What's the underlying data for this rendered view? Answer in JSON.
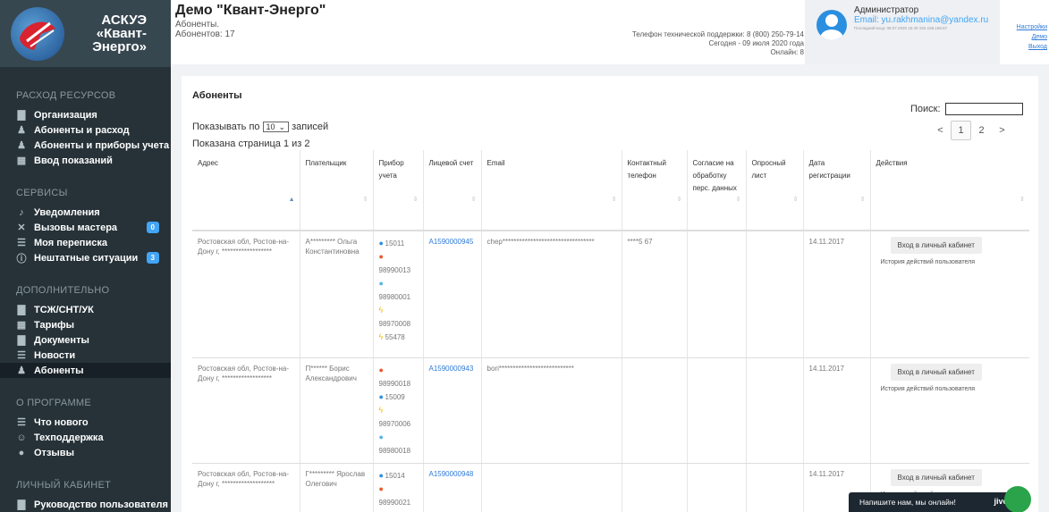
{
  "brand": {
    "line1": "АСКУЭ",
    "line2": "«Квант-",
    "line3": "Энерго»"
  },
  "sidebar": {
    "sections": [
      {
        "title": "РАСХОД РЕСУРСОВ",
        "items": [
          {
            "label": "Организация",
            "icon": "folder-icon"
          },
          {
            "label": "Абоненты и расход",
            "icon": "user-icon"
          },
          {
            "label": "Абоненты и приборы учета",
            "icon": "user-icon"
          },
          {
            "label": "Ввод показаний",
            "icon": "chart-icon"
          }
        ]
      },
      {
        "title": "СЕРВИСЫ",
        "items": [
          {
            "label": "Уведомления",
            "icon": "bell-icon"
          },
          {
            "label": "Вызовы мастера",
            "icon": "tools-icon",
            "badge": "0"
          },
          {
            "label": "Моя переписка",
            "icon": "list-icon"
          },
          {
            "label": "Нештатные ситуации",
            "icon": "alert-icon",
            "badge": "3"
          }
        ]
      },
      {
        "title": "ДОПОЛНИТЕЛЬНО",
        "items": [
          {
            "label": "ТСЖ/СНТ/УК",
            "icon": "folder-icon"
          },
          {
            "label": "Тарифы",
            "icon": "chart-icon"
          },
          {
            "label": "Документы",
            "icon": "folder-icon"
          },
          {
            "label": "Новости",
            "icon": "list-icon"
          },
          {
            "label": "Абоненты",
            "icon": "user-icon",
            "active": true
          }
        ]
      },
      {
        "title": "О ПРОГРАММЕ",
        "items": [
          {
            "label": "Что нового",
            "icon": "list-icon"
          },
          {
            "label": "Техподдержка",
            "icon": "support-icon"
          },
          {
            "label": "Отзывы",
            "icon": "comment-icon"
          }
        ]
      },
      {
        "title": "ЛИЧНЫЙ КАБИНЕТ",
        "items": [
          {
            "label": "Руководство пользователя",
            "icon": "folder-icon"
          }
        ]
      }
    ]
  },
  "header": {
    "title": "Демо \"Квант-Энерго\"",
    "subtitle1": "Абоненты.",
    "subtitle2": "Абонентов: 17",
    "support": "Телефон технической поддержки: 8 (800) 250-79-14",
    "today": "Сегодня - 09 июля 2020 года",
    "online": "Онлайн: 8",
    "user_name": "Администратор",
    "user_email": "Email: yu.rakhmanina@yandex.ru",
    "last_login": "Последний вход: 08.07.2020 15:40 192.168.158.67",
    "links": [
      "Настройки",
      "Демо",
      "Выход"
    ]
  },
  "panel": {
    "title": "Абоненты",
    "search_label": "Поиск:",
    "show_prefix": "Показывать по",
    "show_value": "10",
    "show_suffix": "записей",
    "shown_page": "Показана страница 1 из 2",
    "pager": {
      "prev": "<",
      "pages": [
        "1",
        "2"
      ],
      "next": ">"
    }
  },
  "table": {
    "columns": [
      "Адрес",
      "Плательщик",
      "Прибор учета",
      "Лицевой счет",
      "Email",
      "Контактный телефон",
      "Согласие на обработку перс. данных",
      "Опросный лист",
      "Дата регистрации",
      "Действия"
    ],
    "rows": [
      {
        "address": "Ростовская обл, Ростов-на-Дону г, ******************",
        "payer": "А********* Ольга Константиновна",
        "meters": [
          {
            "type": "blue",
            "no": "15011"
          },
          {
            "type": "red",
            "no": ""
          },
          {
            "type": "none",
            "no": "98990013"
          },
          {
            "type": "lblue",
            "no": ""
          },
          {
            "type": "none",
            "no": "98980001"
          },
          {
            "type": "yel",
            "no": ""
          },
          {
            "type": "none",
            "no": "98970008"
          },
          {
            "type": "yel",
            "no": "55478"
          }
        ],
        "account": "А1590000945",
        "email": "chep*********************************",
        "phone": "****5 67",
        "date": "14.11.2017",
        "login": "Вход в личный кабинет",
        "history": "История действий пользователя"
      },
      {
        "address": "Ростовская обл, Ростов-на-Дону г, ******************",
        "payer": "П****** Борис Александрович",
        "meters": [
          {
            "type": "red",
            "no": ""
          },
          {
            "type": "none",
            "no": "98990018"
          },
          {
            "type": "blue",
            "no": "15009"
          },
          {
            "type": "yel",
            "no": ""
          },
          {
            "type": "none",
            "no": "98970006"
          },
          {
            "type": "lblue",
            "no": ""
          },
          {
            "type": "none",
            "no": "98980018"
          }
        ],
        "account": "А1590000943",
        "email": "bori***************************",
        "phone": "",
        "date": "14.11.2017",
        "login": "Вход в личный кабинет",
        "history": "История действий пользователя"
      },
      {
        "address": "Ростовская обл, Ростов-на-Дону г, *******************",
        "payer": "Г********* Ярослав Олегович",
        "meters": [
          {
            "type": "blue",
            "no": "15014"
          },
          {
            "type": "red",
            "no": ""
          },
          {
            "type": "none",
            "no": "98990021"
          },
          {
            "type": "lblue",
            "no": ""
          }
        ],
        "account": "А1590000948",
        "email": "",
        "phone": "",
        "date": "14.11.2017",
        "login": "Вход в личный кабинет",
        "history": "История действий пользователя"
      }
    ]
  },
  "chat": {
    "text": "Напишите нам, мы онлайн!",
    "brand": "jivo"
  },
  "colors": {
    "sidebar": "#263238",
    "accent": "#2f7bd8",
    "badge": "#42a5f5"
  }
}
